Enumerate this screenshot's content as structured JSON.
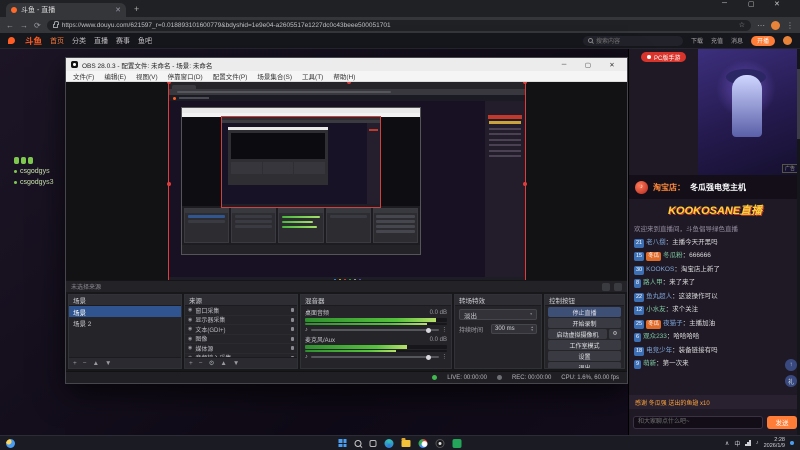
{
  "icons": {
    "close": "✕",
    "min": "─",
    "max": "▢",
    "plus": "+",
    "minus": "−",
    "back": "←",
    "forward": "→",
    "reload": "⟳",
    "star": "☆",
    "menu": "⋮",
    "up": "▲",
    "down": "▼",
    "caret_down": "▾",
    "caret_up": "▴",
    "eye": "◉",
    "gear": "⚙",
    "audio": "♪",
    "dots": "⋯",
    "arrow_up": "↑",
    "gift": "礼",
    "caret": "∧"
  },
  "browser": {
    "tab_title": "斗鱼 - 直播",
    "url": "https://www.douyu.com/621597_r=0.018893101600779&bdyshid=1e9e04-a2605517e1227dc0c43beee500051701"
  },
  "site": {
    "logo": "斗鱼",
    "nav": [
      "首页",
      "分类",
      "直播",
      "赛事",
      "鱼吧"
    ],
    "search_placeholder": "搜索内容",
    "right": [
      "下载",
      "充值",
      "消息"
    ],
    "live_button": "开播"
  },
  "page": {
    "labels": [
      "csgodgys",
      "csgodgys3"
    ],
    "pc_button": "PC版手游",
    "ad_tag": "广告"
  },
  "banner": {
    "prefix": "淘宝店：",
    "title": "冬瓜强电竞主机",
    "logo": "KOOKOSANE直播"
  },
  "chat": {
    "notice": "欢迎来到直播间，斗鱼倡导绿色直播",
    "messages": [
      {
        "badge": "21",
        "user": "老八捌",
        "text": "主播今天开黑吗"
      },
      {
        "badge": "15",
        "fan": "冬瓜",
        "user": "冬瓜粉",
        "text": "666666"
      },
      {
        "badge": "30",
        "user": "KOOKOS",
        "text": "淘宝店上新了"
      },
      {
        "badge": "8",
        "user": "路人甲",
        "text": "来了来了"
      },
      {
        "badge": "22",
        "user": "鱼丸超人",
        "text": "这波操作可以"
      },
      {
        "badge": "12",
        "user": "小水友",
        "text": "求个关注"
      },
      {
        "badge": "25",
        "fan": "冬瓜",
        "user": "夜猫子",
        "text": "主播加油"
      },
      {
        "badge": "6",
        "user": "观众233",
        "text": "哈哈哈哈"
      },
      {
        "badge": "18",
        "user": "电竞少年",
        "text": "装备链接有吗"
      },
      {
        "badge": "9",
        "user": "萌新",
        "text": "第一次来"
      }
    ],
    "gift_notice": "感谢 冬瓜强 送出的鱼翅 x10",
    "input_placeholder": "和大家聊点什么吧~",
    "send": "发送"
  },
  "obs": {
    "title": "OBS 28.0.3 - 配置文件: 未命名 - 场景: 未命名",
    "menus": [
      "文件(F)",
      "编辑(E)",
      "视图(V)",
      "停靠窗口(D)",
      "配置文件(P)",
      "场景集合(S)",
      "工具(T)",
      "帮助(H)"
    ],
    "source_toolbar": "未选择来源",
    "scenes": {
      "title": "场景",
      "items": [
        "场景",
        "场景 2"
      ]
    },
    "sources": {
      "title": "来源",
      "items": [
        "窗口采集",
        "显示器采集",
        "文本(GDI+)",
        "图像",
        "媒体源",
        "音频输入采集"
      ]
    },
    "mixer": {
      "title": "混音器",
      "channels": [
        {
          "name": "桌面音频",
          "db": "0.0 dB"
        },
        {
          "name": "麦克风/Aux",
          "db": "0.0 dB"
        }
      ]
    },
    "transitions": {
      "title": "转场特效",
      "type": "淡出",
      "duration_label": "持续时间",
      "duration": "300 ms"
    },
    "controls": {
      "title": "控制按钮",
      "buttons": [
        "停止直播",
        "开始录制",
        "启动虚拟摄像机",
        "工作室模式",
        "设置",
        "退出"
      ]
    },
    "status": {
      "live": "LIVE: 00:00:00",
      "rec": "REC: 00:00:00",
      "cpu": "CPU: 1.6%, 60.00 fps"
    }
  },
  "taskbar": {
    "ime": "中",
    "time": "2:28",
    "date": "2026/1/9"
  },
  "colors": {
    "douyu_orange": "#ff5d23",
    "accent_button": "#ff7d37",
    "live_green": "#3fb950",
    "meter_green": "#55c23c",
    "selection_blue": "#2f548f",
    "source_outline_red": "#e03c3c"
  }
}
